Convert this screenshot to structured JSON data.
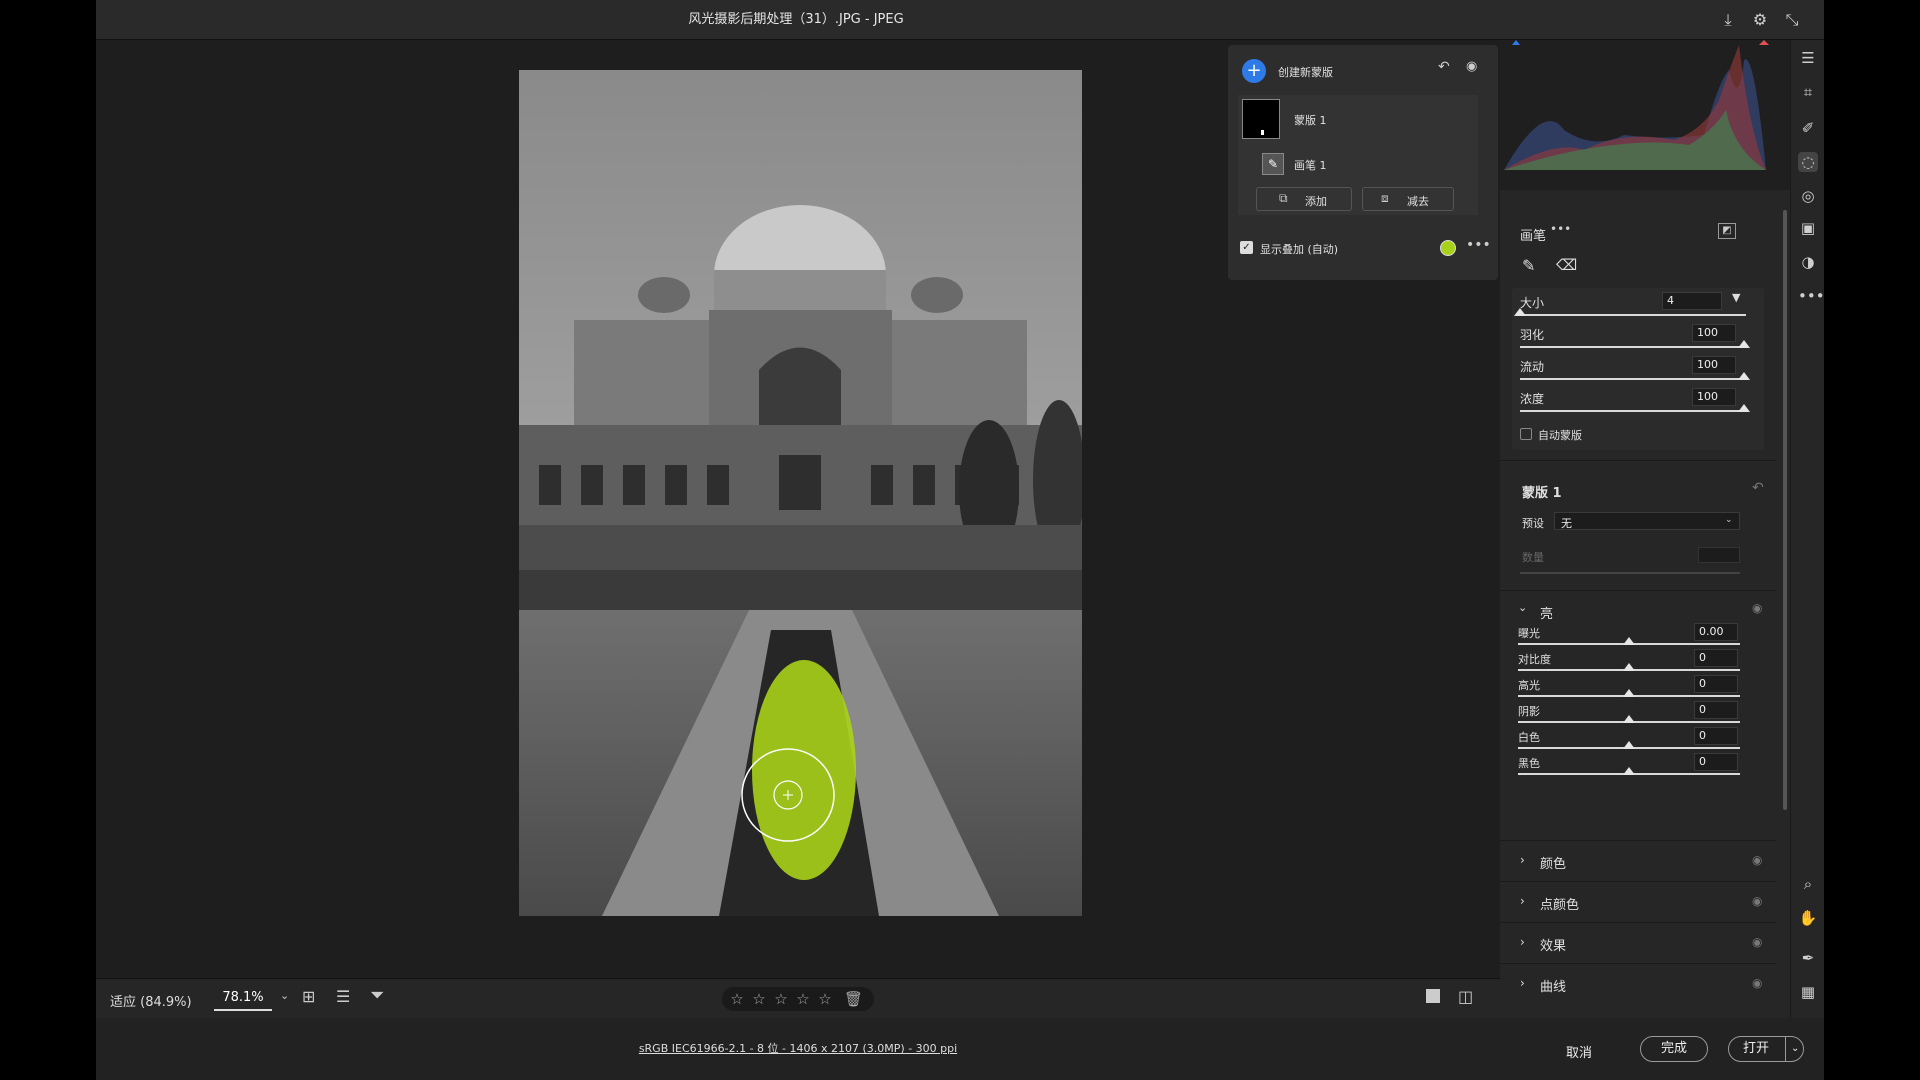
{
  "window": {
    "title": "风光摄影后期处理（31）.JPG -  JPEG"
  },
  "toolbar_icons": [
    "download-icon",
    "gear-icon",
    "collapse-icon"
  ],
  "mask_panel": {
    "create_label": "创建新蒙版",
    "mask_name": "蒙版 1",
    "brush_name": "画笔 1",
    "add_label": "添加",
    "subtract_label": "减去",
    "overlay_label": "显示叠加 (自动)",
    "overlay_color": "#a8d21a"
  },
  "brush": {
    "title": "画笔",
    "size_label": "大小",
    "size_value": "4",
    "feather_label": "羽化",
    "feather_value": "100",
    "flow_label": "流动",
    "flow_value": "100",
    "density_label": "浓度",
    "density_value": "100",
    "automask_label": "自动蒙版"
  },
  "mask_settings": {
    "title": "蒙版 1",
    "preset_label": "预设",
    "preset_value": "无",
    "amount_label": "数量"
  },
  "light": {
    "title": "亮",
    "sliders": [
      {
        "label": "曝光",
        "value": "0.00"
      },
      {
        "label": "对比度",
        "value": "0"
      },
      {
        "label": "高光",
        "value": "0"
      },
      {
        "label": "阴影",
        "value": "0"
      },
      {
        "label": "白色",
        "value": "0"
      },
      {
        "label": "黑色",
        "value": "0"
      }
    ]
  },
  "collapsed_sections": [
    "颜色",
    "点颜色",
    "效果",
    "曲线"
  ],
  "bottom": {
    "zoom_fit": "适应 (84.9%)",
    "zoom_value": "78.1%",
    "info": "sRGB IEC61966-2.1 - 8 位 - 1406 x 2107 (3.0MP) - 300 ppi",
    "cancel": "取消",
    "done": "完成",
    "open": "打开"
  }
}
